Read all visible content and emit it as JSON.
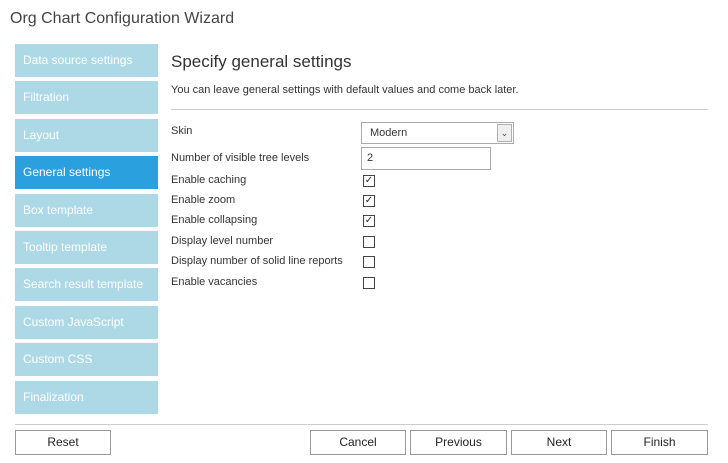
{
  "window": {
    "title": "Org Chart Configuration Wizard"
  },
  "sidebar": {
    "items": [
      {
        "label": "Data source settings"
      },
      {
        "label": "Filtration"
      },
      {
        "label": "Layout"
      },
      {
        "label": "General settings",
        "active": true
      },
      {
        "label": "Box template"
      },
      {
        "label": "Tooltip template"
      },
      {
        "label": "Search result template"
      },
      {
        "label": "Custom JavaScript"
      },
      {
        "label": "Custom CSS"
      },
      {
        "label": "Finalization"
      }
    ]
  },
  "main": {
    "heading": "Specify general settings",
    "subtitle": "You can leave general settings with default values and come back later.",
    "skin": {
      "label": "Skin",
      "value": "Modern",
      "arrow_icon": "chevron-down-icon"
    },
    "levels": {
      "label": "Number of visible tree levels",
      "value": "2"
    },
    "options": [
      {
        "label": "Enable caching",
        "checked": true
      },
      {
        "label": "Enable zoom",
        "checked": true
      },
      {
        "label": "Enable collapsing",
        "checked": true
      },
      {
        "label": "Display level number",
        "checked": false
      },
      {
        "label": "Display number of solid line reports",
        "checked": false
      },
      {
        "label": "Enable vacancies",
        "checked": false
      }
    ]
  },
  "footer": {
    "reset": "Reset",
    "cancel": "Cancel",
    "previous": "Previous",
    "next": "Next",
    "finish": "Finish"
  },
  "colors": {
    "sidebar_item": "#add8e6",
    "sidebar_active": "#2aa0de"
  }
}
